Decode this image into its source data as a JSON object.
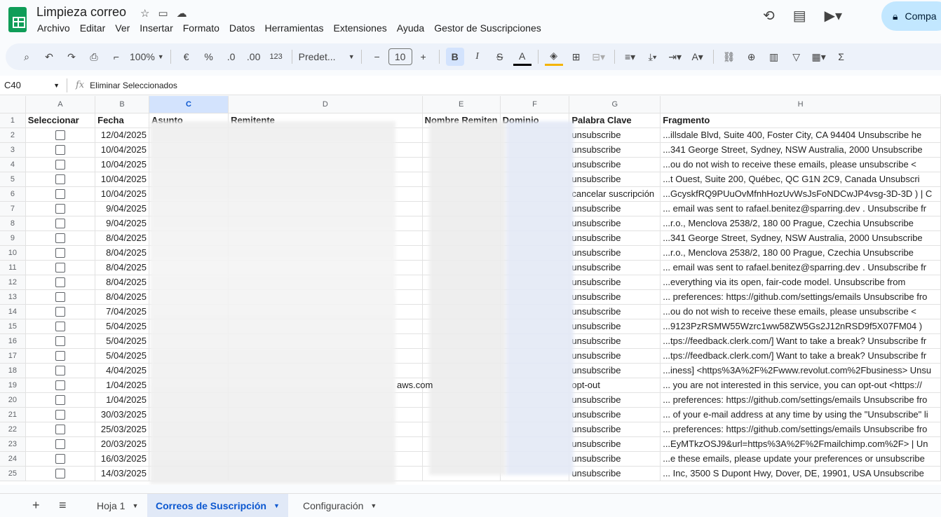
{
  "app": {
    "title": "Limpieza correo",
    "share_label": "Compa"
  },
  "menu": [
    "Archivo",
    "Editar",
    "Ver",
    "Insertar",
    "Formato",
    "Datos",
    "Herramientas",
    "Extensiones",
    "Ayuda",
    "Gestor de Suscripciones"
  ],
  "toolbar": {
    "zoom": "100%",
    "currency": "€",
    "percent": "%",
    "dec_down": ".0",
    "dec_up": ".00",
    "number_fmt": "123",
    "font": "Predet...",
    "font_size": "10",
    "bold": "B",
    "italic": "I",
    "strike": "S",
    "text_color": "A",
    "sigma": "Σ"
  },
  "formula_bar": {
    "cell_ref": "C40",
    "fx": "fx",
    "content": "Eliminar Seleccionados"
  },
  "columns": [
    "A",
    "B",
    "C",
    "D",
    "E",
    "F",
    "G",
    "H"
  ],
  "header_row": {
    "A": "Seleccionar",
    "B": "Fecha",
    "C": "Asunto",
    "D": "Remitente",
    "E": "Nombre Remiten",
    "F": "Dominio",
    "G": "Palabra Clave",
    "H": "Fragmento"
  },
  "rows": [
    {
      "n": "2",
      "date": "12/04/2025",
      "kw": "unsubscribe",
      "frag": "...illsdale Blvd, Suite 400, Foster City, CA 94404   Unsubscribe he"
    },
    {
      "n": "3",
      "date": "10/04/2025",
      "kw": "unsubscribe",
      "frag": "...341 George Street, Sydney, NSW Australia, 2000    Unsubscribe"
    },
    {
      "n": "4",
      "date": "10/04/2025",
      "kw": "unsubscribe",
      "frag": "...ou do not wish to receive these    emails, please unsubscribe    <"
    },
    {
      "n": "5",
      "date": "10/04/2025",
      "kw": "unsubscribe",
      "frag": "...t Ouest, Suite 200, Québec, QC G1N 2C9, Canada    Unsubscri"
    },
    {
      "n": "6",
      "date": "10/04/2025",
      "kw": "cancelar suscripción",
      "frag": "...GcyskfRQ9PUuOvMfnhHozUvWsJsFoNDCwJP4vsg-3D-3D ) | C"
    },
    {
      "n": "7",
      "date": "9/04/2025",
      "kw": "unsubscribe",
      "frag": "... email was sent to rafael.benitez@sparring.dev .  Unsubscribe fr"
    },
    {
      "n": "8",
      "date": "9/04/2025",
      "kw": "unsubscribe",
      "frag": "...r.o., Menclova 2538/2, 180 00 Prague, Czechia     Unsubscribe"
    },
    {
      "n": "9",
      "date": "8/04/2025",
      "kw": "unsubscribe",
      "frag": "...341 George Street, Sydney, NSW Australia, 2000    Unsubscribe"
    },
    {
      "n": "10",
      "date": "8/04/2025",
      "kw": "unsubscribe",
      "frag": "...r.o., Menclova 2538/2, 180 00 Prague, Czechia     Unsubscribe"
    },
    {
      "n": "11",
      "date": "8/04/2025",
      "kw": "unsubscribe",
      "frag": "... email was sent to rafael.benitez@sparring.dev .  Unsubscribe fr"
    },
    {
      "n": "12",
      "date": "8/04/2025",
      "kw": "unsubscribe",
      "frag": "...everything via its open, fair-code model.        Unsubscribe from"
    },
    {
      "n": "13",
      "date": "8/04/2025",
      "kw": "unsubscribe",
      "frag": "... preferences: https://github.com/settings/emails  Unsubscribe fro"
    },
    {
      "n": "14",
      "date": "7/04/2025",
      "kw": "unsubscribe",
      "frag": "...ou do not wish to receive these emails,    please unsubscribe    <"
    },
    {
      "n": "15",
      "date": "5/04/2025",
      "kw": "unsubscribe",
      "frag": "...9123PzRSMW55Wzrc1ww58ZW5Gs2J12nRSD9f5X07FM04 )"
    },
    {
      "n": "16",
      "date": "5/04/2025",
      "kw": "unsubscribe",
      "frag": "...tps://feedback.clerk.com/]  Want to take a break? Unsubscribe fr"
    },
    {
      "n": "17",
      "date": "5/04/2025",
      "kw": "unsubscribe",
      "frag": "...tps://feedback.clerk.com/]  Want to take a break? Unsubscribe fr"
    },
    {
      "n": "18",
      "date": "4/04/2025",
      "kw": "unsubscribe",
      "frag": "...iness] <https%3A%2F%2Fwww.revolut.com%2Fbusiness> Unsu"
    },
    {
      "n": "19",
      "date": "1/04/2025",
      "kw": "opt-out",
      "frag": "... you are not interested in  this service, you can opt-out  <https://"
    },
    {
      "n": "20",
      "date": "1/04/2025",
      "kw": "unsubscribe",
      "frag": "... preferences: https://github.com/settings/emails  Unsubscribe fro"
    },
    {
      "n": "21",
      "date": "30/03/2025",
      "kw": "unsubscribe",
      "frag": "... of your e-mail address at any time by using the \"Unsubscribe\" li"
    },
    {
      "n": "22",
      "date": "25/03/2025",
      "kw": "unsubscribe",
      "frag": "... preferences: https://github.com/settings/emails  Unsubscribe fro"
    },
    {
      "n": "23",
      "date": "20/03/2025",
      "kw": "unsubscribe",
      "frag": "...EyMTkzOSJ9&url=https%3A%2F%2Fmailchimp.com%2F>  | Un"
    },
    {
      "n": "24",
      "date": "16/03/2025",
      "kw": "unsubscribe",
      "frag": "...e these emails, please update your preferences or unsubscribe"
    },
    {
      "n": "25",
      "date": "14/03/2025",
      "kw": "unsubscribe",
      "frag": "... Inc, 3500 S Dupont Hwy, Dover, DE, 19901, USA    Unsubscribe"
    }
  ],
  "row19_d_tail": "aws.com",
  "sheets": [
    {
      "label": "Hoja 1"
    },
    {
      "label": "Correos de Suscripción"
    },
    {
      "label": "Configuración"
    }
  ]
}
